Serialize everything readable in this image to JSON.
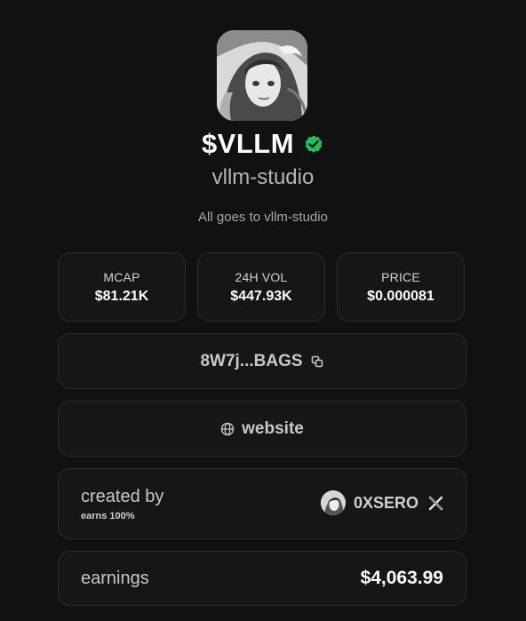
{
  "token": {
    "ticker": "$VLLM",
    "name": "vllm-studio",
    "description": "All goes to vllm-studio",
    "verified": true,
    "avatar_icon": "anime-portrait-avatar"
  },
  "stats": [
    {
      "label": "MCAP",
      "value": "$81.21K"
    },
    {
      "label": "24H VOL",
      "value": "$447.93K"
    },
    {
      "label": "PRICE",
      "value": "$0.000081"
    }
  ],
  "contract": {
    "address": "8W7j...BAGS",
    "icon": "copy-icon"
  },
  "website": {
    "label": "website",
    "icon": "globe-icon"
  },
  "creator": {
    "title": "created by",
    "earns": "earns 100%",
    "name": "0XSERO",
    "social_icon": "x-icon"
  },
  "earnings": {
    "label": "earnings",
    "value": "$4,063.99"
  },
  "colors": {
    "background": "#111111",
    "card": "#161616",
    "border": "#2c2c2c",
    "verified": "#1ec25a"
  }
}
